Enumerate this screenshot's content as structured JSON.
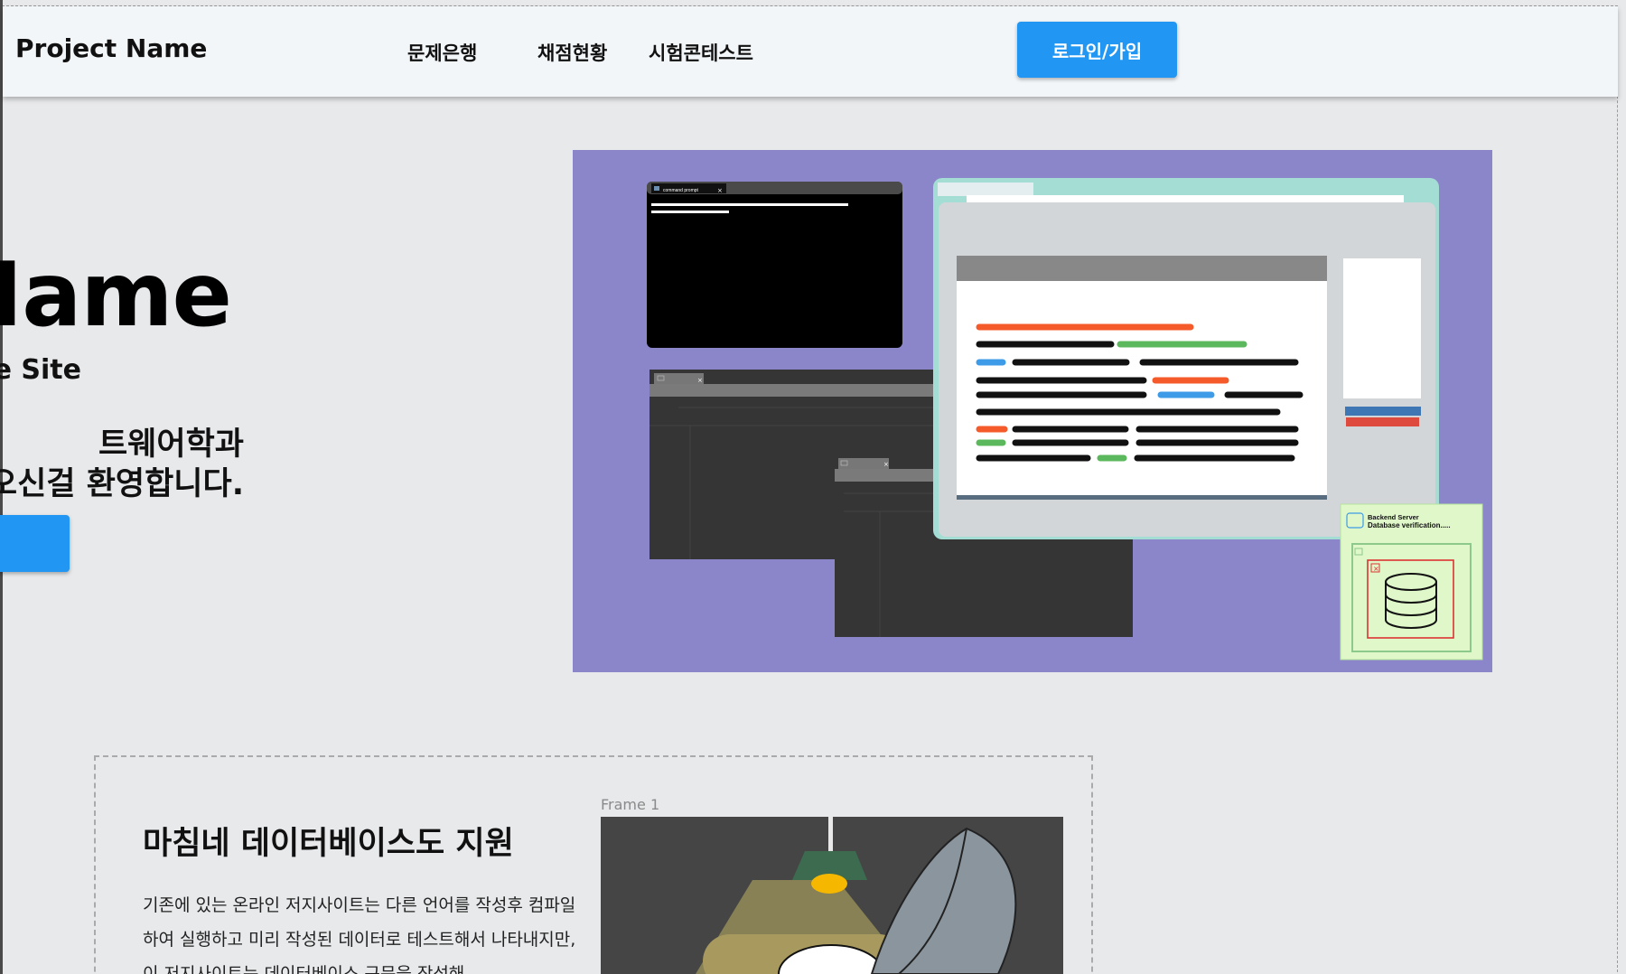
{
  "header": {
    "brand": "Project Name",
    "nav": [
      "문제은행",
      "채점현황",
      "시험콘테스트"
    ],
    "login_label": "로그인/가입"
  },
  "hero": {
    "title": "Name",
    "subtitle": "je Site",
    "desc_line1": "트웨어학과",
    "desc_line2": "오신걸 환영합니다.",
    "illustration": {
      "cmd_title": "command prompt",
      "db_panel_line1": "Backend Server",
      "db_panel_line2": "Database verification....."
    }
  },
  "feature": {
    "title": "마침네 데이터베이스도 지원",
    "body": "기존에 있는 온라인 저지사이트는 다른 언어를 작성후 컴파일하여 실행하고 미리 작성된 데이터로 테스트해서 나타내지만, 이 저지사이트는 데이터베이스 구문을 작성해",
    "frame_label": "Frame 1"
  },
  "colors": {
    "accent": "#2196f3",
    "illustration_bg": "#8b86c9",
    "header_bg": "#f3f6f9",
    "page_bg": "#e8e9eb"
  }
}
